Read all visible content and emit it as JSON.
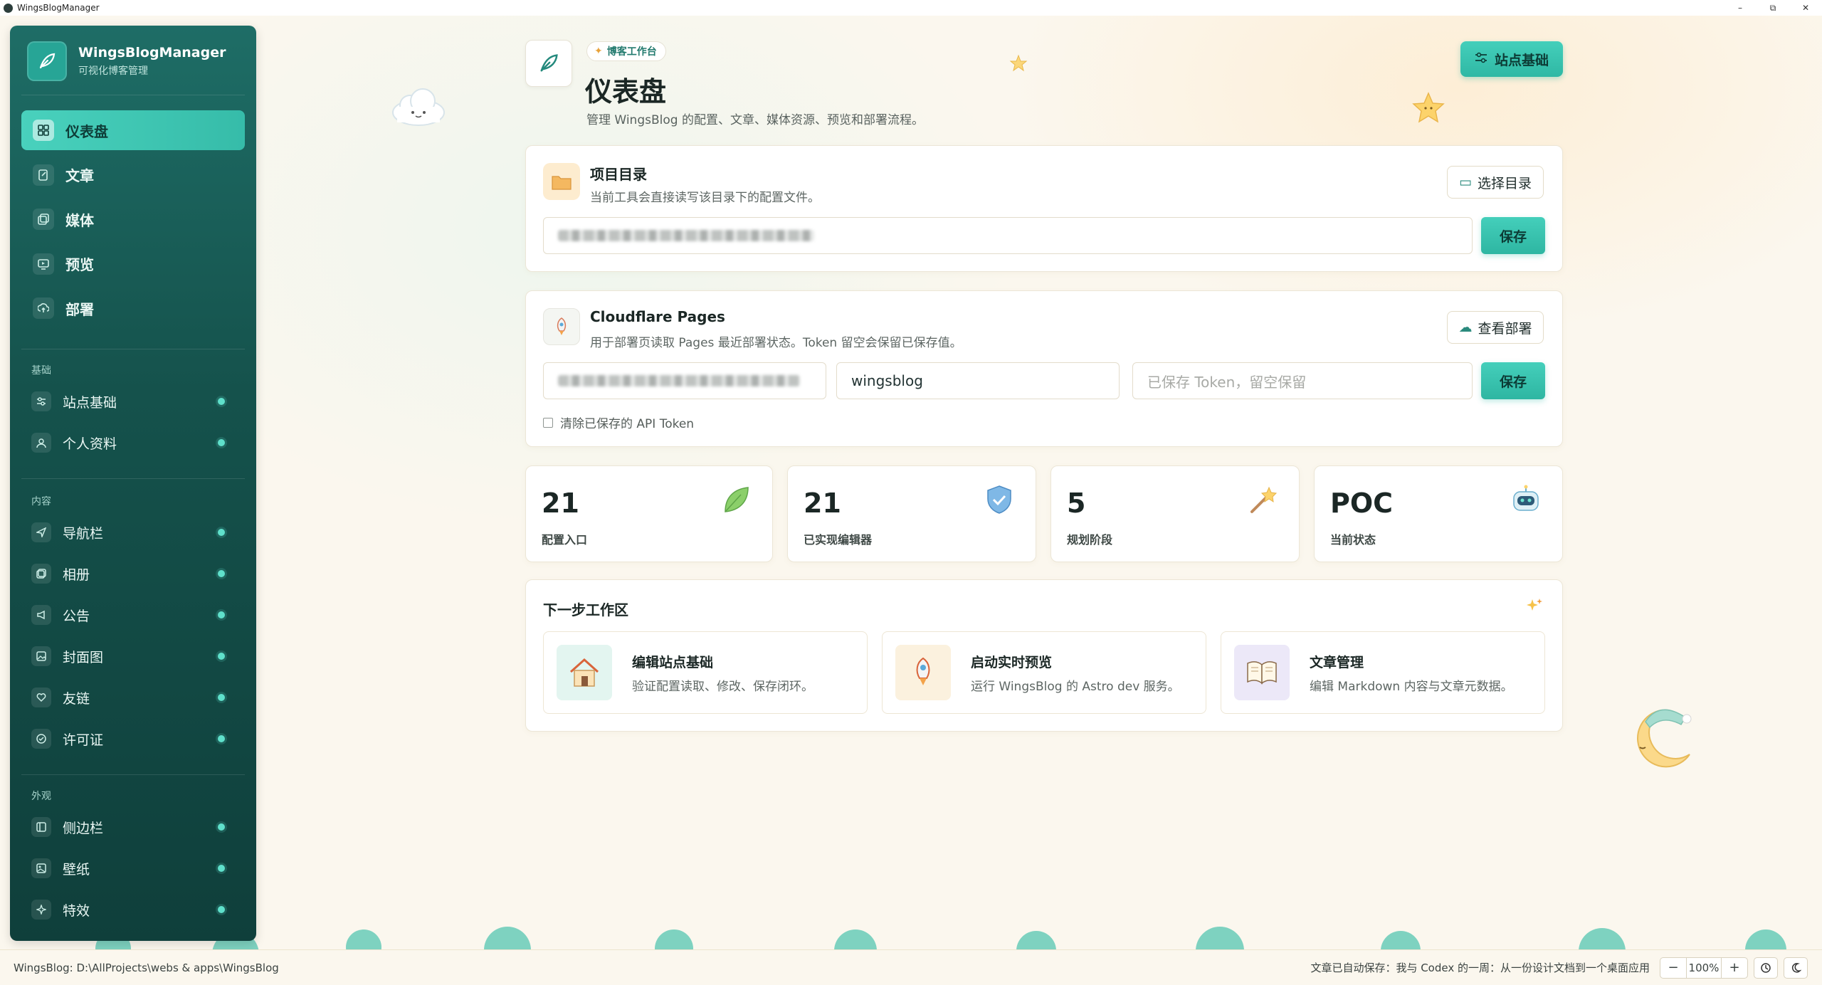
{
  "window": {
    "title": "WingsBlogManager",
    "minimize": "–",
    "restore": "⧉",
    "close": "✕"
  },
  "brand": {
    "name": "WingsBlogManager",
    "subtitle": "可视化博客管理"
  },
  "main_nav": [
    {
      "label": "仪表盘",
      "icon": "dashboard-icon",
      "active": true
    },
    {
      "label": "文章",
      "icon": "article-icon",
      "active": false
    },
    {
      "label": "媒体",
      "icon": "media-icon",
      "active": false
    },
    {
      "label": "预览",
      "icon": "preview-icon",
      "active": false
    },
    {
      "label": "部署",
      "icon": "deploy-icon",
      "active": false
    }
  ],
  "sections": [
    {
      "label": "基础",
      "items": [
        {
          "label": "站点基础",
          "icon": "sliders-icon"
        },
        {
          "label": "个人资料",
          "icon": "user-icon"
        }
      ]
    },
    {
      "label": "内容",
      "items": [
        {
          "label": "导航栏",
          "icon": "navigation-icon"
        },
        {
          "label": "相册",
          "icon": "album-icon"
        },
        {
          "label": "公告",
          "icon": "megaphone-icon"
        },
        {
          "label": "封面图",
          "icon": "cover-image-icon"
        },
        {
          "label": "友链",
          "icon": "heart-link-icon"
        },
        {
          "label": "许可证",
          "icon": "license-icon"
        }
      ]
    },
    {
      "label": "外观",
      "items": [
        {
          "label": "侧边栏",
          "icon": "sidebar-icon"
        },
        {
          "label": "壁纸",
          "icon": "wallpaper-icon"
        },
        {
          "label": "特效",
          "icon": "sparkle-effects-icon"
        }
      ]
    }
  ],
  "header": {
    "badge": "博客工作台",
    "title": "仪表盘",
    "subtitle": "管理 WingsBlog 的配置、文章、媒体资源、预览和部署流程。",
    "action_button": "站点基础"
  },
  "project_card": {
    "title": "项目目录",
    "description": "当前工具会直接读写该目录下的配置文件。",
    "choose_button": "选择目录",
    "save_button": "保存"
  },
  "cloudflare_card": {
    "title": "Cloudflare Pages",
    "description": "用于部署页读取 Pages 最近部署状态。Token 留空会保留已保存值。",
    "view_button": "查看部署",
    "project_name_value": "wingsblog",
    "token_placeholder": "已保存 Token，留空保留",
    "save_button": "保存",
    "clear_token_label": "清除已保存的 API Token"
  },
  "stats": [
    {
      "value": "21",
      "label": "配置入口",
      "icon": "leaf-icon"
    },
    {
      "value": "21",
      "label": "已实现编辑器",
      "icon": "shield-check-icon"
    },
    {
      "value": "5",
      "label": "规划阶段",
      "icon": "magic-wand-icon"
    },
    {
      "value": "POC",
      "label": "当前状态",
      "icon": "robot-icon"
    }
  ],
  "next_steps": {
    "title": "下一步工作区",
    "cards": [
      {
        "title": "编辑站点基础",
        "description": "验证配置读取、修改、保存闭环。",
        "icon": "house-icon"
      },
      {
        "title": "启动实时预览",
        "description": "运行 WingsBlog 的 Astro dev 服务。",
        "icon": "rocket-icon"
      },
      {
        "title": "文章管理",
        "description": "编辑 Markdown 内容与文章元数据。",
        "icon": "book-icon"
      }
    ]
  },
  "statusbar": {
    "path": "WingsBlog: D:\\AllProjects\\webs & apps\\WingsBlog",
    "message": "文章已自动保存：我与 Codex 的一周：从一份设计文档到一个桌面应用",
    "zoom": "100%",
    "zoom_out": "−",
    "zoom_in": "+"
  },
  "colors": {
    "sidebar_top": "#1e6d66",
    "sidebar_bottom": "#0f3f3b",
    "accent": "#3cc6b1",
    "background": "#fbf7ee"
  }
}
